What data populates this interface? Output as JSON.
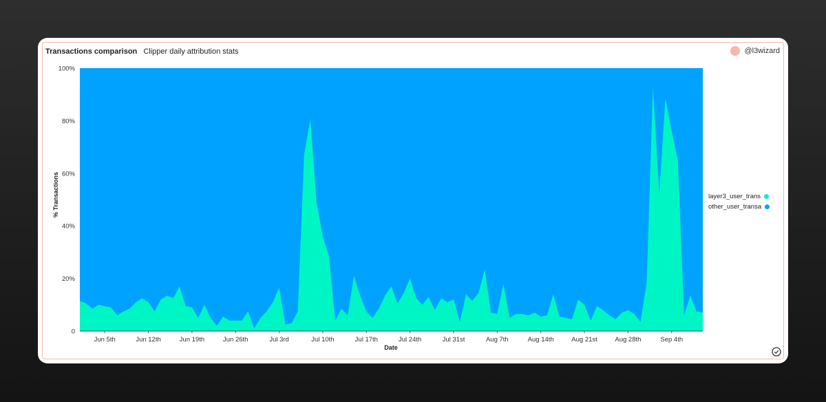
{
  "header": {
    "title": "Transactions comparison",
    "subtitle": "Clipper daily attribution stats"
  },
  "user": {
    "handle": "@l3wizard"
  },
  "colors": {
    "layer3": "#00f5c4",
    "other": "#00a2ff",
    "accent": "#f4b7ae"
  },
  "icons": {
    "status": "check-circle-icon"
  },
  "chart_data": {
    "type": "area",
    "stacked_percent": true,
    "xlabel": "Date",
    "ylabel": "% Transactions",
    "ylim": [
      0,
      100
    ],
    "yticks": [
      "0",
      "20%",
      "40%",
      "60%",
      "80%",
      "100%"
    ],
    "x_start": "Jun 1st",
    "xticks": [
      "Jun 5th",
      "Jun 12th",
      "Jun 19th",
      "Jun 26th",
      "Jul 3rd",
      "Jul 10th",
      "Jul 17th",
      "Jul 24th",
      "Jul 31st",
      "Aug 7th",
      "Aug 14th",
      "Aug 21st",
      "Aug 28th",
      "Sep 4th"
    ],
    "legend_position": "right",
    "grid": false,
    "series": [
      {
        "name": "layer3_user_trans",
        "color": "#00f5c4",
        "values": [
          11.5,
          10.5,
          8.5,
          10,
          9.5,
          9,
          6,
          7.5,
          8.5,
          11,
          12.5,
          11,
          7.5,
          12,
          13.5,
          12.5,
          17,
          9.5,
          9,
          5,
          10,
          5,
          2,
          5.5,
          4,
          4,
          4,
          7.5,
          1,
          5,
          7.5,
          11,
          16.5,
          2.5,
          3,
          7.5,
          67,
          80.5,
          49,
          36,
          28.5,
          4,
          8.5,
          6,
          21,
          13.5,
          7.5,
          5,
          8.5,
          13.5,
          17,
          10.5,
          14.5,
          20,
          12.5,
          10,
          13,
          8,
          12.5,
          11,
          12,
          3.5,
          14,
          11.5,
          14.5,
          23.5,
          7,
          6.5,
          18,
          5,
          6.5,
          6.5,
          6,
          7,
          5.5,
          6,
          14,
          5.5,
          5,
          4.5,
          12,
          10,
          4,
          9.5,
          8,
          6,
          4.5,
          7,
          8,
          6.5,
          3.5,
          18.5,
          92.5,
          52,
          88.5,
          76,
          65,
          6,
          13.5,
          7.5,
          7
        ]
      },
      {
        "name": "other_user_transa",
        "color": "#00a2ff"
      }
    ]
  }
}
